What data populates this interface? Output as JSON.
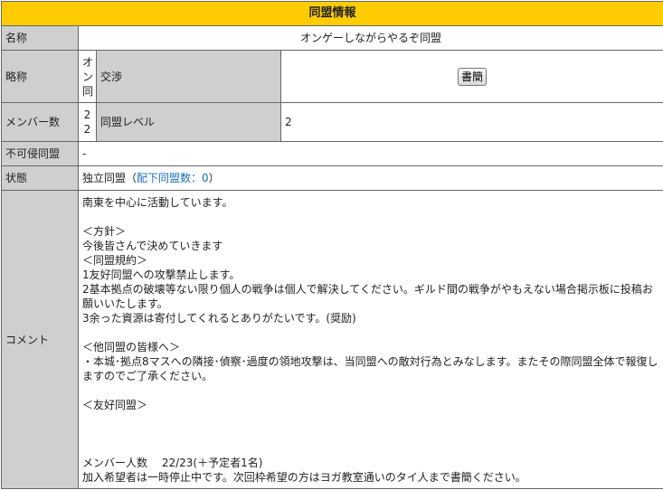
{
  "header": {
    "title": "同盟情報"
  },
  "rows": {
    "name": {
      "label": "名称",
      "value": "オンゲーしながらやるぞ同盟"
    },
    "abbr": {
      "label": "略称",
      "value_chars": [
        "オ",
        "ン",
        "同"
      ],
      "negotiation_label": "交渉",
      "letter_button": "書簡"
    },
    "members": {
      "label": "メンバー数",
      "value_chars": [
        "2",
        "2"
      ],
      "level_label": "同盟レベル",
      "level_value": "2"
    },
    "nonaggression": {
      "label": "不可侵同盟",
      "value": "-"
    },
    "status": {
      "label": "状態",
      "value": "独立同盟",
      "open_paren": "（",
      "subordinate_link": "配下同盟数：0",
      "close_paren": "）"
    },
    "comment": {
      "label": "コメント",
      "text": "南東を中心に活動しています。\n\n＜方針＞\n今後皆さんで決めていきます\n＜同盟規約＞\n1友好同盟への攻撃禁止します。\n2基本拠点の破壊等ない限り個人の戦争は個人で解決してください。ギルド間の戦争がやもえない場合掲示板に投稿お願いいたします。\n3余った資源は寄付してくれるとありがたいです。(奨励)\n\n＜他同盟の皆様へ＞\n・本城･拠点8マスへの隣接･偵察･過度の領地攻撃は、当同盟への敵対行為とみなします。またその際同盟全体で報復しますのでご了承ください。\n\n＜友好同盟＞\n\n\n\nメンバー人数　 22/23(＋予定者1名)\n加入希望者は一時停止中です。次回枠希望の方はヨガ教室通いのタイ人まで書簡ください。"
    }
  },
  "colors": {
    "header_bg": "#ffcc00",
    "label_bg": "#cfcfcf",
    "link": "#1a6fbf",
    "border": "#666666"
  }
}
